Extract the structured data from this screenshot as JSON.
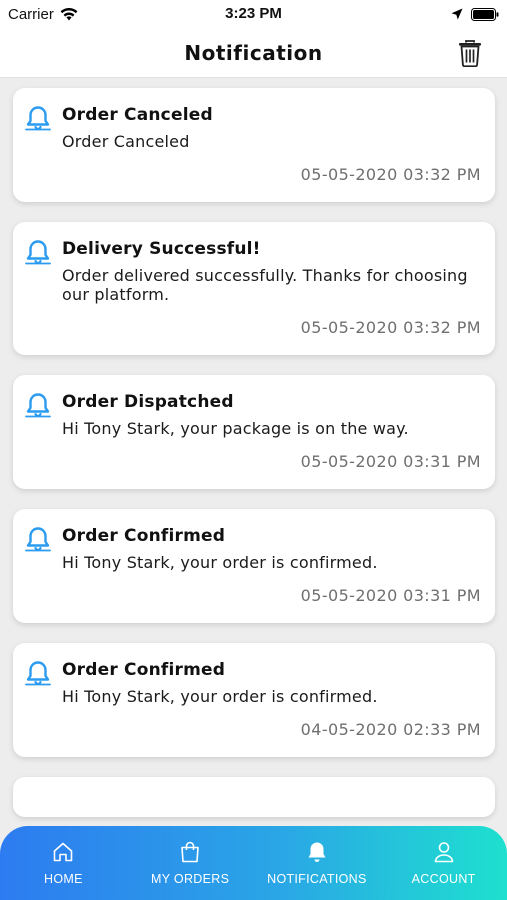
{
  "status_bar": {
    "carrier": "Carrier",
    "time": "3:23 PM"
  },
  "header": {
    "title": "Notification",
    "trash_icon": "trash-icon"
  },
  "notifications": [
    {
      "title": "Order Canceled",
      "message": "Order Canceled",
      "timestamp": "05-05-2020 03:32 PM"
    },
    {
      "title": "Delivery Successful!",
      "message": "Order delivered successfully. Thanks for choosing our platform.",
      "timestamp": "05-05-2020 03:32 PM"
    },
    {
      "title": "Order Dispatched",
      "message": "Hi Tony Stark, your package is on the way.",
      "timestamp": "05-05-2020 03:31 PM"
    },
    {
      "title": "Order Confirmed",
      "message": "Hi Tony Stark, your order is confirmed.",
      "timestamp": "05-05-2020 03:31 PM"
    },
    {
      "title": "Order Confirmed",
      "message": "Hi Tony Stark, your order is confirmed.",
      "timestamp": "04-05-2020 02:33 PM"
    }
  ],
  "tab_bar": {
    "items": [
      {
        "label": "HOME",
        "icon": "home-icon"
      },
      {
        "label": "MY ORDERS",
        "icon": "shopping-bag-icon"
      },
      {
        "label": "NOTIFICATIONS",
        "icon": "bell-icon"
      },
      {
        "label": "ACCOUNT",
        "icon": "user-icon"
      }
    ]
  },
  "colors": {
    "bell_icon": "#2a9bf0",
    "tab_gradient_start": "#2d7bf0",
    "tab_gradient_end": "#1ee0cf",
    "timestamp": "#6f6f6f"
  }
}
